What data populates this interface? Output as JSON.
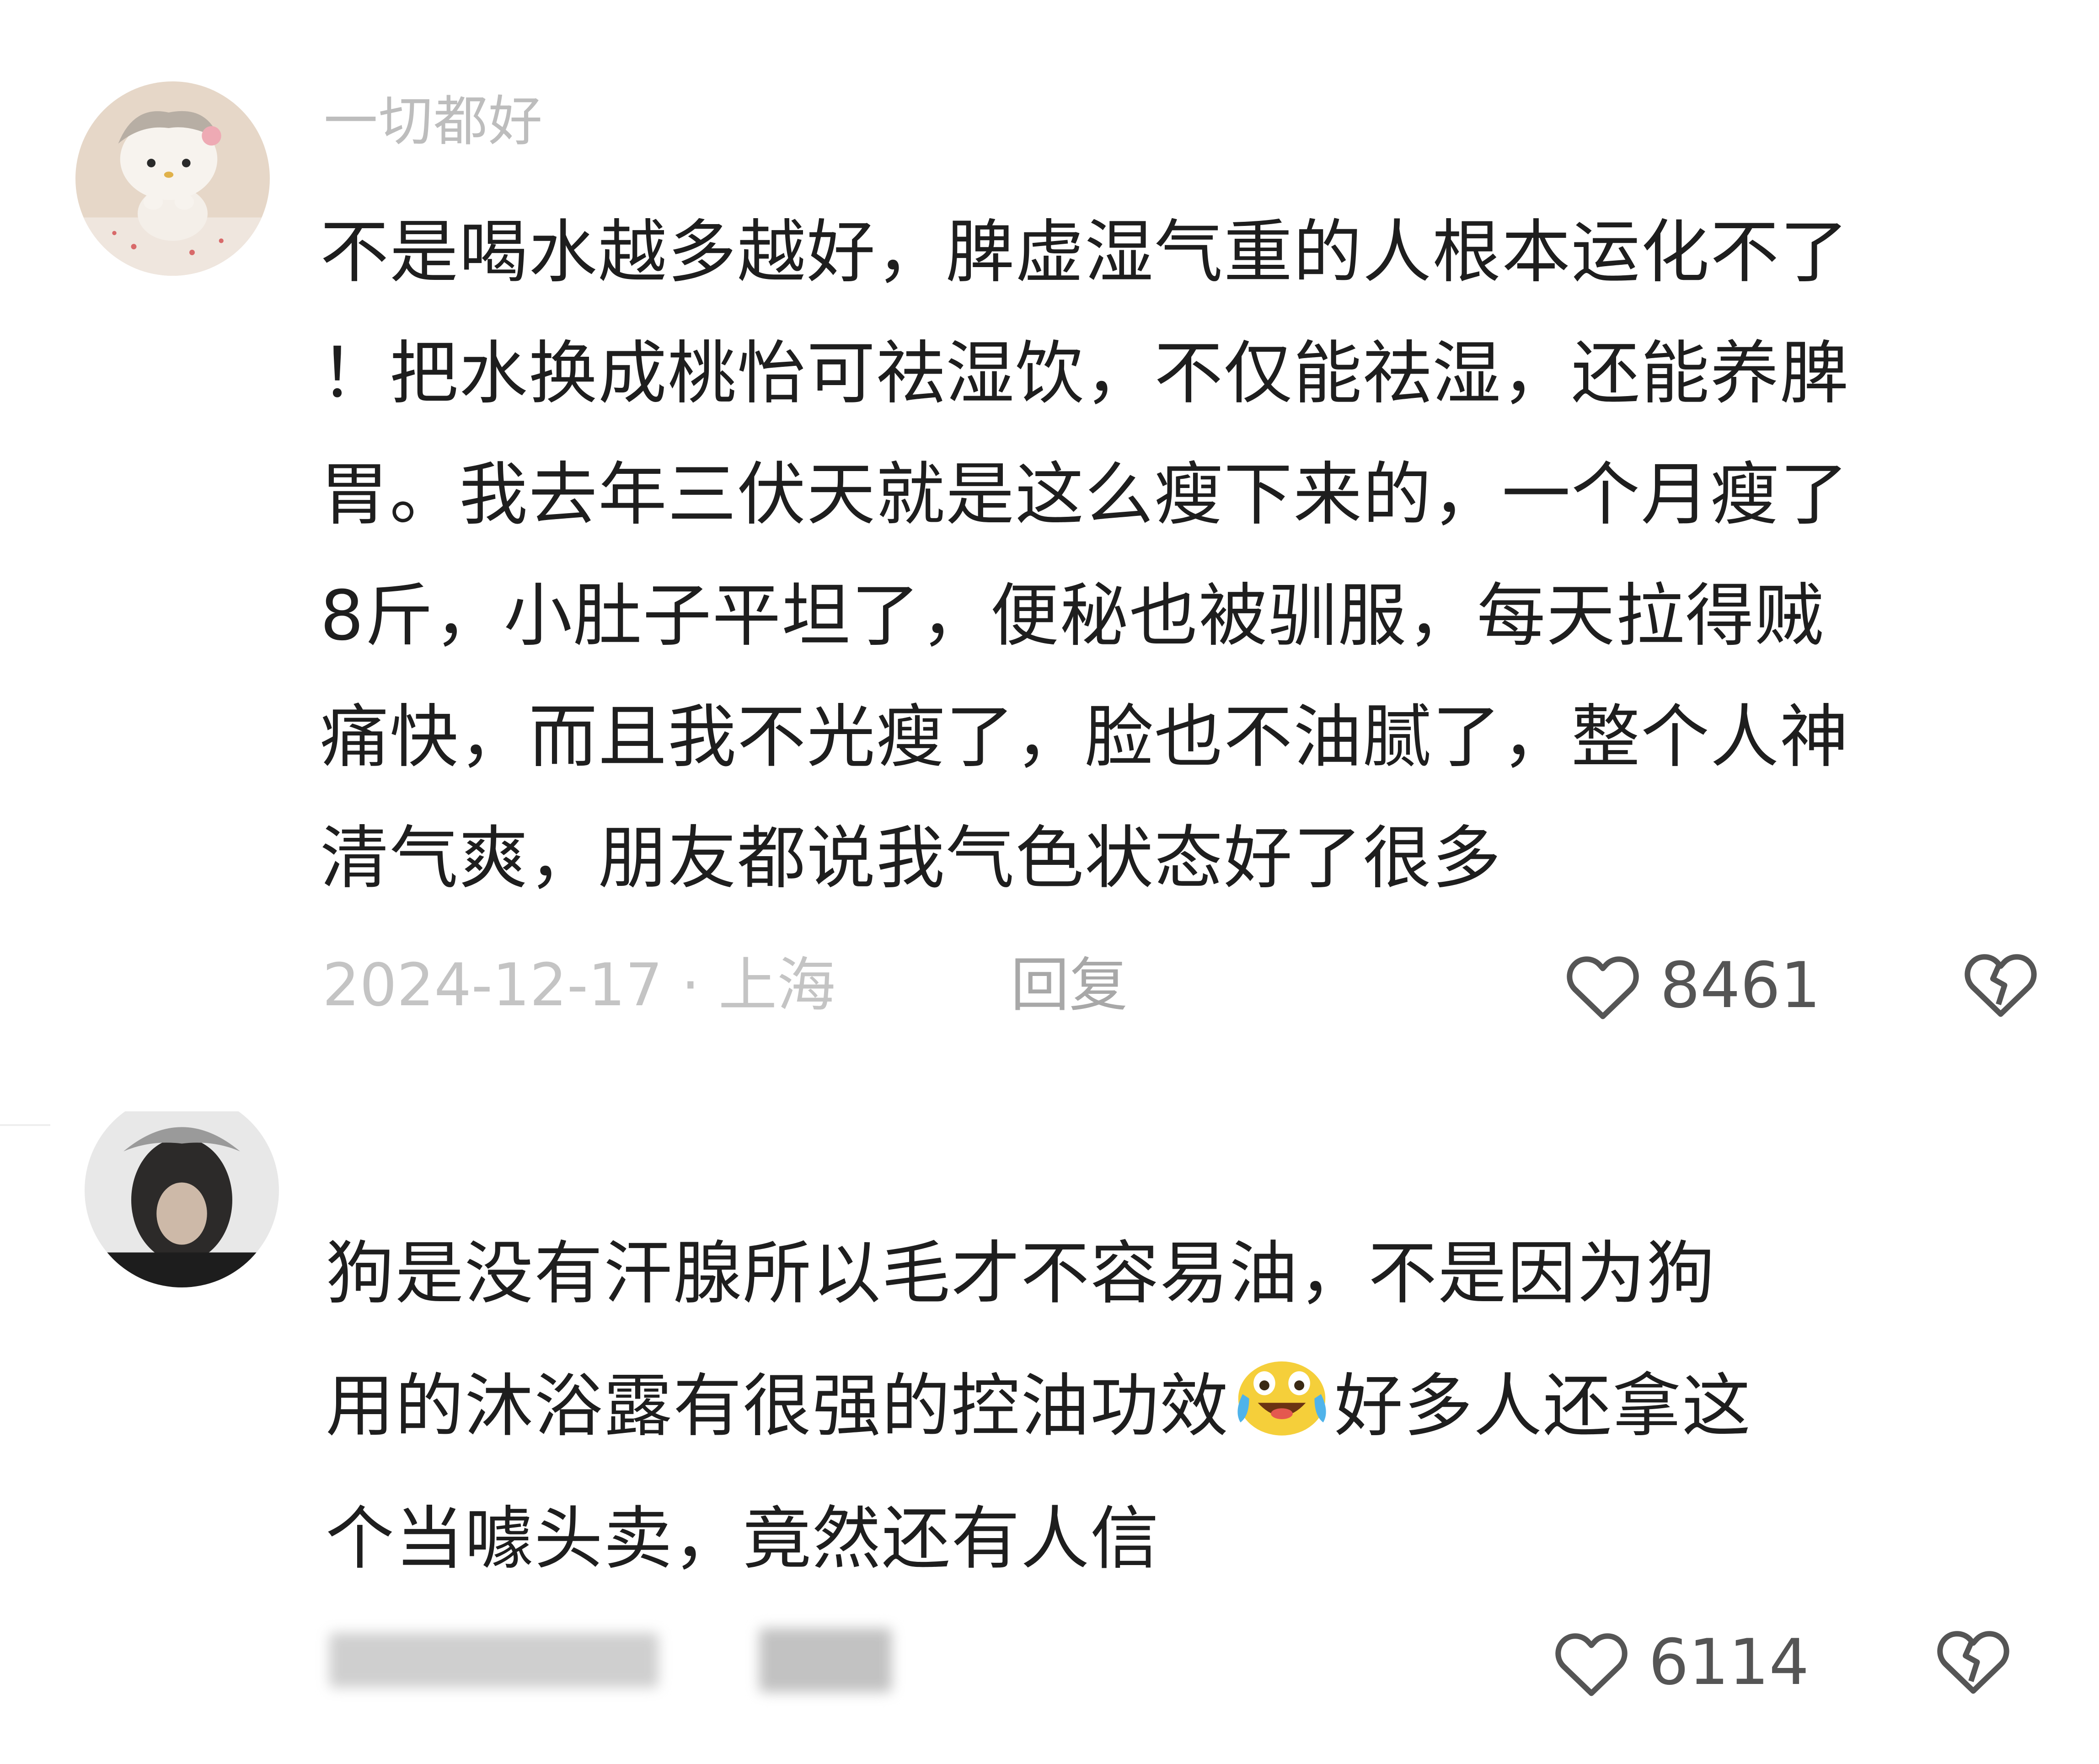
{
  "comments": [
    {
      "username": "一切都好",
      "avatar_icon": "hello-kitty-avatar",
      "text_lines": [
        "不是喝水越多越好，脾虚湿气重的人根本运化不了",
        "！把水换成桃怡可祛湿饮，不仅能祛湿，还能养脾",
        "胃。我去年三伏天就是这么瘦下来的，一个月瘦了",
        "8斤，小肚子平坦了，便秘也被驯服，每天拉得贼",
        "痛快，而且我不光瘦了，脸也不油腻了，整个人神",
        "清气爽，朋友都说我气色状态好了很多"
      ],
      "date_location": "2024-12-17 · 上海",
      "reply_label": "回复",
      "like_count": "8461",
      "like_icon": "heart-outline-icon",
      "dislike_icon": "broken-heart-icon"
    },
    {
      "avatar_icon": "person-avatar",
      "text_part1_lines": [
        "狗是没有汗腺所以毛才不容易油，不是因为狗",
        "用的沐浴露有很强的控油功效"
      ],
      "emoji_icon": "crying-laughing-emoji-icon",
      "text_part2_after_emoji": "好多人还拿这",
      "text_last_line": "个当噱头卖，竟然还有人信",
      "like_count": "6114",
      "like_icon": "heart-outline-icon",
      "dislike_icon": "broken-heart-icon"
    }
  ],
  "colors": {
    "username": "#bdbdbd",
    "text": "#1e1e1e",
    "meta": "#c4c4c4",
    "count": "#555555"
  }
}
